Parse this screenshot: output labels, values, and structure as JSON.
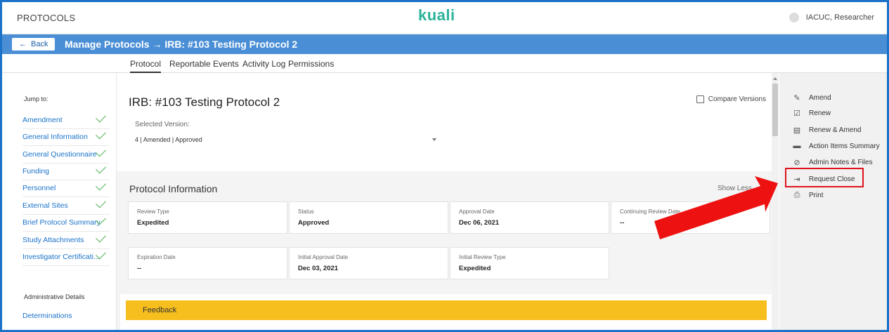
{
  "header": {
    "app_name": "PROTOCOLS",
    "logo": "kuali",
    "user": "IACUC, Researcher"
  },
  "nav": {
    "back_label": "Back",
    "breadcrumb": "Manage Protocols → IRB: #103 Testing Protocol 2"
  },
  "tabs": [
    "Protocol",
    "Reportable Events",
    "Activity Log",
    "Permissions"
  ],
  "sidebar": {
    "jump_to": "Jump to:",
    "items": [
      {
        "label": "Amendment"
      },
      {
        "label": "General Information"
      },
      {
        "label": "General Questionnaire"
      },
      {
        "label": "Funding"
      },
      {
        "label": "Personnel"
      },
      {
        "label": "External Sites"
      },
      {
        "label": "Brief Protocol Summary"
      },
      {
        "label": "Study Attachments"
      },
      {
        "label": "Investigator Certificati..."
      }
    ],
    "admin_heading": "Administrative Details",
    "admin_items": [
      "Determinations"
    ]
  },
  "protocol": {
    "title": "IRB: #103 Testing Protocol 2",
    "compare_versions": "Compare Versions",
    "selected_version_label": "Selected Version:",
    "selected_version_value": "4 | Amended | Approved"
  },
  "info": {
    "heading": "Protocol Information",
    "show_less": "Show Less",
    "fields": [
      {
        "label": "Review Type",
        "value": "Expedited"
      },
      {
        "label": "Status",
        "value": "Approved"
      },
      {
        "label": "Approval Date",
        "value": "Dec 06, 2021"
      },
      {
        "label": "Continuing Review Date",
        "value": "--"
      },
      {
        "label": "Expiration Date",
        "value": "--"
      },
      {
        "label": "Initial Approval Date",
        "value": "Dec 03, 2021"
      },
      {
        "label": "Initial Review Type",
        "value": "Expedited"
      }
    ]
  },
  "feedback": {
    "heading": "Feedback"
  },
  "actions": [
    {
      "label": "Amend",
      "icon": "pencil-icon"
    },
    {
      "label": "Renew",
      "icon": "calendar-check-icon"
    },
    {
      "label": "Renew & Amend",
      "icon": "calendar-edit-icon"
    },
    {
      "label": "Action Items Summary",
      "icon": "comment-icon"
    },
    {
      "label": "Admin Notes & Files",
      "icon": "paperclip-icon"
    },
    {
      "label": "Request Close",
      "icon": "exit-icon"
    },
    {
      "label": "Print",
      "icon": "printer-icon"
    }
  ],
  "colors": {
    "accent_blue": "#4a8fd6",
    "brand_green": "#2bb39a",
    "feedback_yellow": "#f6bf1e",
    "highlight_red": "#e0121c"
  }
}
